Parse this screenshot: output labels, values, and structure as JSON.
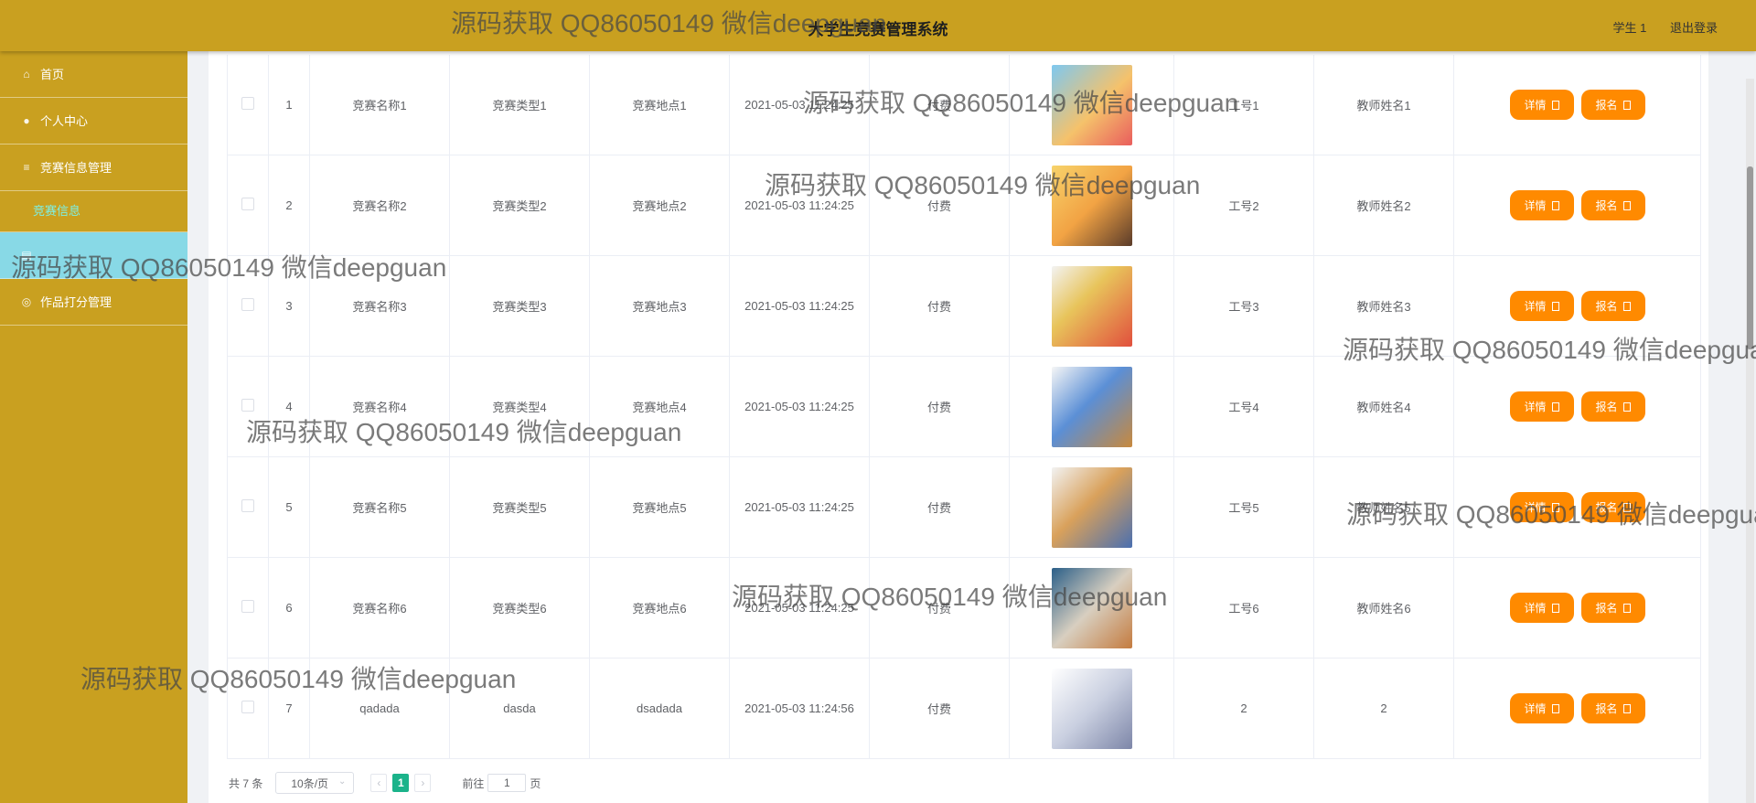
{
  "header": {
    "title": "大学生竞赛管理系统",
    "user": "学生 1",
    "logout": "退出登录"
  },
  "sidebar": {
    "items": [
      {
        "label": "首页",
        "icon": "home-icon"
      },
      {
        "label": "个人中心",
        "icon": "user-icon"
      },
      {
        "label": "竞赛信息管理",
        "icon": "menu-icon"
      },
      {
        "label": "竞赛信息",
        "sub": true
      },
      {
        "label": "",
        "icon": "file-icon",
        "active": true
      },
      {
        "label": "作品打分管理",
        "icon": "score-icon"
      }
    ]
  },
  "table": {
    "rows": [
      {
        "index": "1",
        "name": "竞赛名称1",
        "type": "竞赛类型1",
        "location": "竞赛地点1",
        "time": "2021-05-03 11:24:25",
        "fee": "付费",
        "image": "child-reading-books",
        "job_id": "工号1",
        "teacher": "教师姓名1"
      },
      {
        "index": "2",
        "name": "竞赛名称2",
        "type": "竞赛类型2",
        "location": "竞赛地点2",
        "time": "2021-05-03 11:24:25",
        "fee": "付费",
        "image": "girl-with-open-book",
        "job_id": "工号2",
        "teacher": "教师姓名2"
      },
      {
        "index": "3",
        "name": "竞赛名称3",
        "type": "竞赛类型3",
        "location": "竞赛地点3",
        "time": "2021-05-03 11:24:25",
        "fee": "付费",
        "image": "school-supplies-clock",
        "job_id": "工号3",
        "teacher": "教师姓名3"
      },
      {
        "index": "4",
        "name": "竞赛名称4",
        "type": "竞赛类型4",
        "location": "竞赛地点4",
        "time": "2021-05-03 11:24:25",
        "fee": "付费",
        "image": "boy-studying-at-desk",
        "job_id": "工号4",
        "teacher": "教师姓名4"
      },
      {
        "index": "5",
        "name": "竞赛名称5",
        "type": "竞赛类型5",
        "location": "竞赛地点5",
        "time": "2021-05-03 11:24:25",
        "fee": "付费",
        "image": "child-with-book-stack",
        "job_id": "工号5",
        "teacher": "教师姓名5"
      },
      {
        "index": "6",
        "name": "竞赛名称6",
        "type": "竞赛类型6",
        "location": "竞赛地点6",
        "time": "2021-05-03 11:24:25",
        "fee": "付费",
        "image": "students-photo",
        "job_id": "工号6",
        "teacher": "教师姓名6"
      },
      {
        "index": "7",
        "name": "qadada",
        "type": "dasda",
        "location": "dsadada",
        "time": "2021-05-03 11:24:56",
        "fee": "付费",
        "image": "anime-cat-girl",
        "job_id": "2",
        "teacher": "2"
      }
    ],
    "detail_label": "详情",
    "signup_label": "报名"
  },
  "pagination": {
    "total": "共 7 条",
    "page_size": "10条/页",
    "current_page": "1",
    "goto_label": "前往",
    "goto_value": "1",
    "page_unit": "页"
  },
  "watermark": "源码获取 QQ86050149 微信deepguan",
  "colors": {
    "accent": "#c9a020",
    "button": "#ff8a00",
    "active_page": "#1bb38a",
    "active_menu": "#88d9e6"
  }
}
